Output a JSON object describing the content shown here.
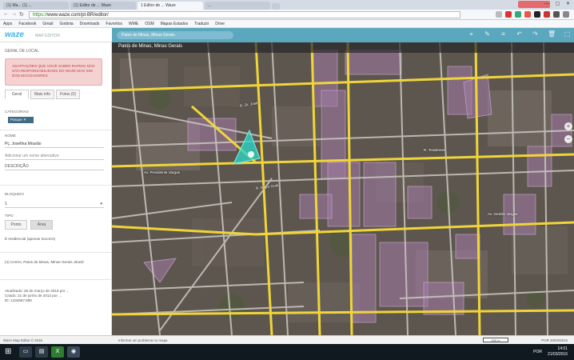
{
  "browser": {
    "tabs": [
      {
        "label": "(1) Ma... (1) ... ",
        "active": false
      },
      {
        "label": "(1) Editor de ... Waze",
        "active": false
      },
      {
        "label": "1 Editor de ... Waze",
        "active": true
      },
      {
        "label": "...",
        "active": false
      }
    ],
    "user_chip": "",
    "window_controls": "— ▢ ✕",
    "nav": {
      "back": "←",
      "forward": "→",
      "reload": "↻"
    },
    "url_secure": "https://",
    "url_rest": "www.waze.com/pt-BR/editor/",
    "bookmarks": [
      "Apps",
      "Facebook",
      "Gmail",
      "Goiânia",
      "Downloads",
      "Favoritos",
      "WME",
      "OSM",
      "Mapas Estados",
      "Traduzir",
      "Drive"
    ]
  },
  "app": {
    "logo": "waze",
    "logo_sub": "MAP EDITOR",
    "location_pill": "Patos de Minas, Minas Gerais"
  },
  "sidebar": {
    "title": "GERAL DE LOCAL",
    "alert": "ADAPTAÇÕES QUE VOCÊ SABER RAPIDO NÃO SÃO RESPONSABILIDADE DO WAZE MAS SIM DOS MAGOADORES",
    "tabs": [
      {
        "label": "Geral",
        "active": true
      },
      {
        "label": "Mais info",
        "active": false
      },
      {
        "label": "Fotos (0)",
        "active": false
      }
    ],
    "categories_label": "CATEGORIAS",
    "category_chip": "Parque ✕",
    "name_label": "NOME",
    "name_value": "Pç. Josefina Mourão",
    "alt_name_placeholder": "Adicionar um nome alternativo",
    "description_label": "DESCRIÇÃO",
    "lock_label": "BLOQUEIO",
    "lock_value": "1",
    "type_label": "TIPO",
    "type_options": [
      {
        "label": "Ponto",
        "active": false
      },
      {
        "label": "Área",
        "active": true
      }
    ],
    "residential_text": "É residencial (apenas Socorro)",
    "address_text": "(4) Centro, Patos de Minas, Minas Gerais, Brasil",
    "update_text": "Atualizado: 28 de março de 2016 por ...\nCriado: 21 de junho de 2013 por ...\nID: 1234567.890"
  },
  "map": {
    "title": "Patos de Minas, Minas Gerais",
    "zoom_in": "+",
    "zoom_out": "−",
    "streets": [
      {
        "label": "R. Dr. José",
        "rot": -10
      },
      {
        "label": "Av. Presidente Vargas",
        "rot": 0
      },
      {
        "label": "R. Major Gote",
        "rot": -8
      },
      {
        "label": "Av. Getúlio Vargas",
        "rot": 0
      },
      {
        "label": "R. Tiradentes",
        "rot": 0
      }
    ]
  },
  "statusbar": {
    "left": "Waze Map Editor © 2016",
    "mid": "Informar um problema no mapa",
    "scale": "200 m",
    "right": "POR 20/03/2016"
  },
  "taskbar": {
    "start": "⊞",
    "lang": "POR",
    "time": "14:01",
    "date": "21/03/2016"
  },
  "colors": {
    "header": "#5aa7be",
    "alert_bg": "#f5d2d2",
    "road": "#f0d53a",
    "selected_area": "#2ed3c4",
    "venue": "#a27ba8"
  }
}
